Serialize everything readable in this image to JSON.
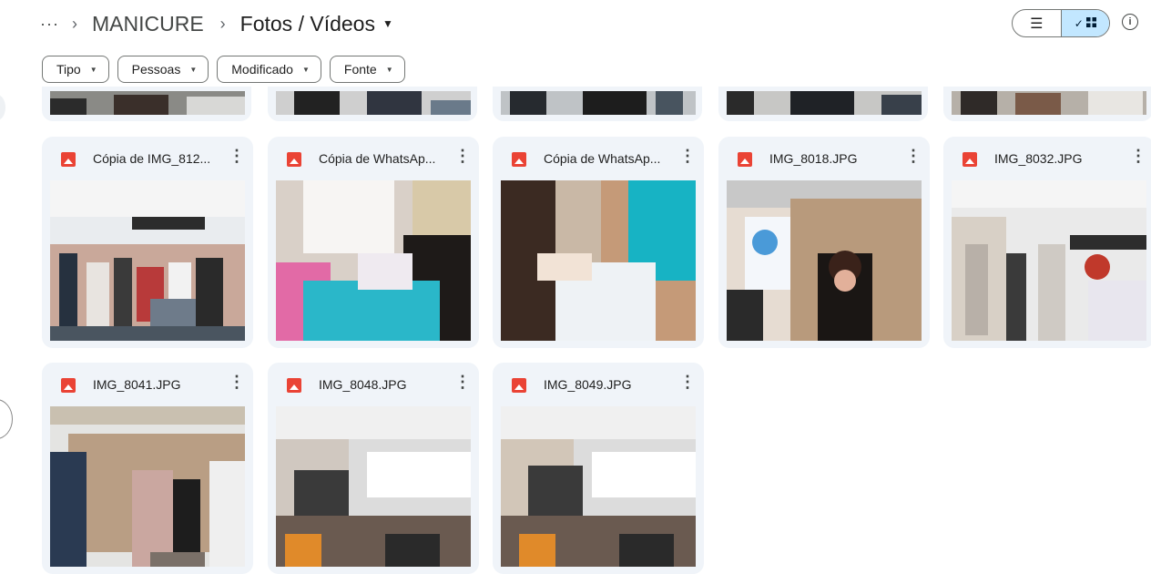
{
  "breadcrumb": {
    "more": "···",
    "folder": "MANICURE",
    "current": "Fotos / Vídeos"
  },
  "view_toggle": {
    "list_icon": "list-icon",
    "grid_icon": "grid-icon",
    "selected": "grid"
  },
  "filters": [
    {
      "label": "Tipo"
    },
    {
      "label": "Pessoas"
    },
    {
      "label": "Modificado"
    },
    {
      "label": "Fonte"
    }
  ],
  "row1": [
    {
      "name": "Cópia de IMG_812..."
    },
    {
      "name": "Cópia de WhatsAp..."
    },
    {
      "name": "Cópia de WhatsAp..."
    },
    {
      "name": "IMG_8018.JPG"
    },
    {
      "name": "IMG_8032.JPG"
    }
  ],
  "row2": [
    {
      "name": "IMG_8041.JPG"
    },
    {
      "name": "IMG_8048.JPG"
    },
    {
      "name": "IMG_8049.JPG"
    }
  ],
  "colors": {
    "accent": "#c2e7ff",
    "card": "#f0f4f9",
    "file_icon": "#ea4335"
  }
}
